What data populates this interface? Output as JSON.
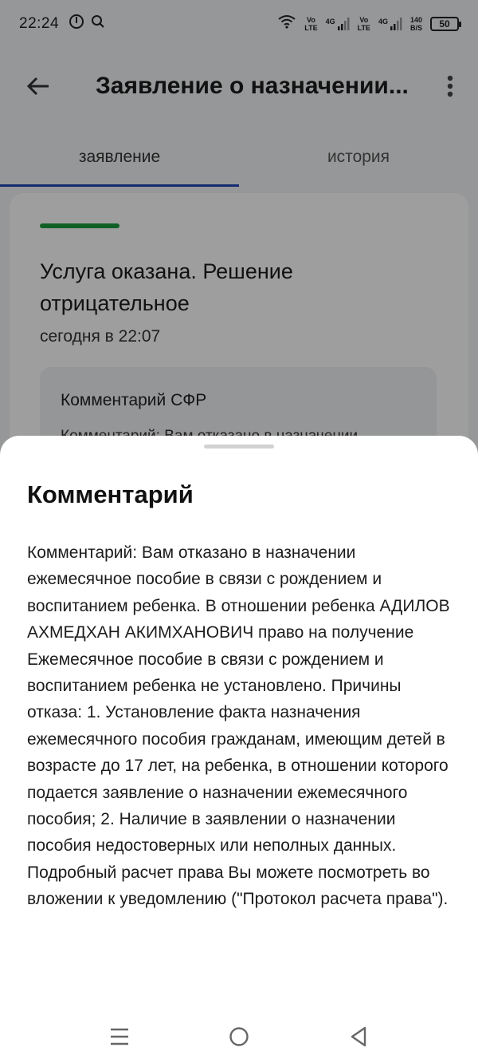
{
  "status_bar": {
    "time": "22:24",
    "net1_top": "Vo",
    "net1_bottom": "LTE",
    "net1_gen": "4G",
    "net2_top": "Vo",
    "net2_bottom": "LTE",
    "net2_gen": "4G",
    "speed_top": "140",
    "speed_bottom": "B/S",
    "battery": "50"
  },
  "app_bar": {
    "title": "Заявление о назначении..."
  },
  "tabs": [
    {
      "label": "заявление",
      "active": true
    },
    {
      "label": "история",
      "active": false
    }
  ],
  "card": {
    "status_title": "Услуга оказана. Решение отрицательное",
    "date": "сегодня в 22:07",
    "comment_label": "Комментарий СФР",
    "comment_preview": "Комментарий: Вам отказано в назначении",
    "accent_color": "#1a9c3e"
  },
  "sheet": {
    "heading": "Комментарий",
    "body": "Комментарий: Вам отказано в назначении ежемесячное пособие в связи с рождением и воспитанием ребенка.  В отношении ребенка АДИЛОВ АХМЕДХАН АКИМХАНОВИЧ право на получение Ежемесячное пособие в связи с рождением и воспитанием ребенка не установлено.  Причины отказа:  1. Установление факта назначения ежемесячного пособия гражданам, имеющим детей в возрасте до 17 лет, на ребенка, в отношении которого подается заявление о назначении ежемесячного пособия; 2. Наличие в заявлении о назначении пособия недостоверных или неполных данных. Подробный расчет права Вы можете посмотреть во вложении к уведомлению (\"Протокол расчета права\")."
  },
  "colors": {
    "tab_indicator": "#1f47b5",
    "status_bar_accent": "#1a9c3e"
  }
}
